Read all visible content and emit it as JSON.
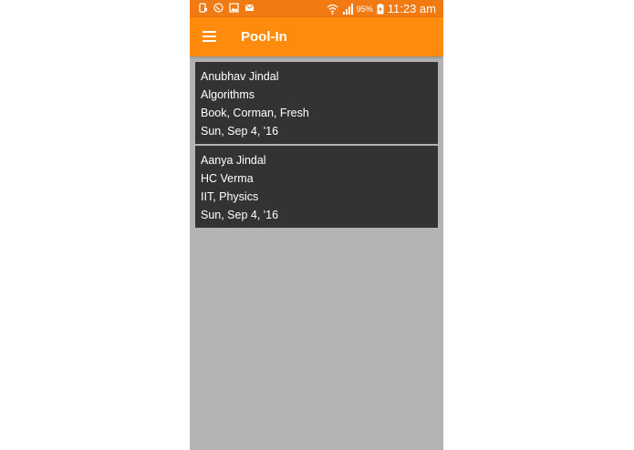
{
  "status_bar": {
    "battery_percent": "95%",
    "time": "11:23 am",
    "icons": [
      "notification-icon",
      "whatsapp-icon",
      "gallery-icon",
      "email-icon",
      "wifi-icon",
      "signal-icon",
      "battery-charging-icon"
    ]
  },
  "app_bar": {
    "title": "Pool-In",
    "menu_icon": "hamburger-menu-icon"
  },
  "colors": {
    "status_bar": "#f27a12",
    "app_bar": "#fe8b0b",
    "background": "#b3b3b3",
    "card": "#333333",
    "text": "#ffffff"
  },
  "items": [
    {
      "name": "Anubhav Jindal",
      "title": "Algorithms",
      "tags": "Book,  Corman,  Fresh",
      "date": "Sun, Sep 4, '16"
    },
    {
      "name": "Aanya Jindal",
      "title": "HC Verma",
      "tags": "IIT, Physics",
      "date": "Sun, Sep 4, '16"
    }
  ]
}
